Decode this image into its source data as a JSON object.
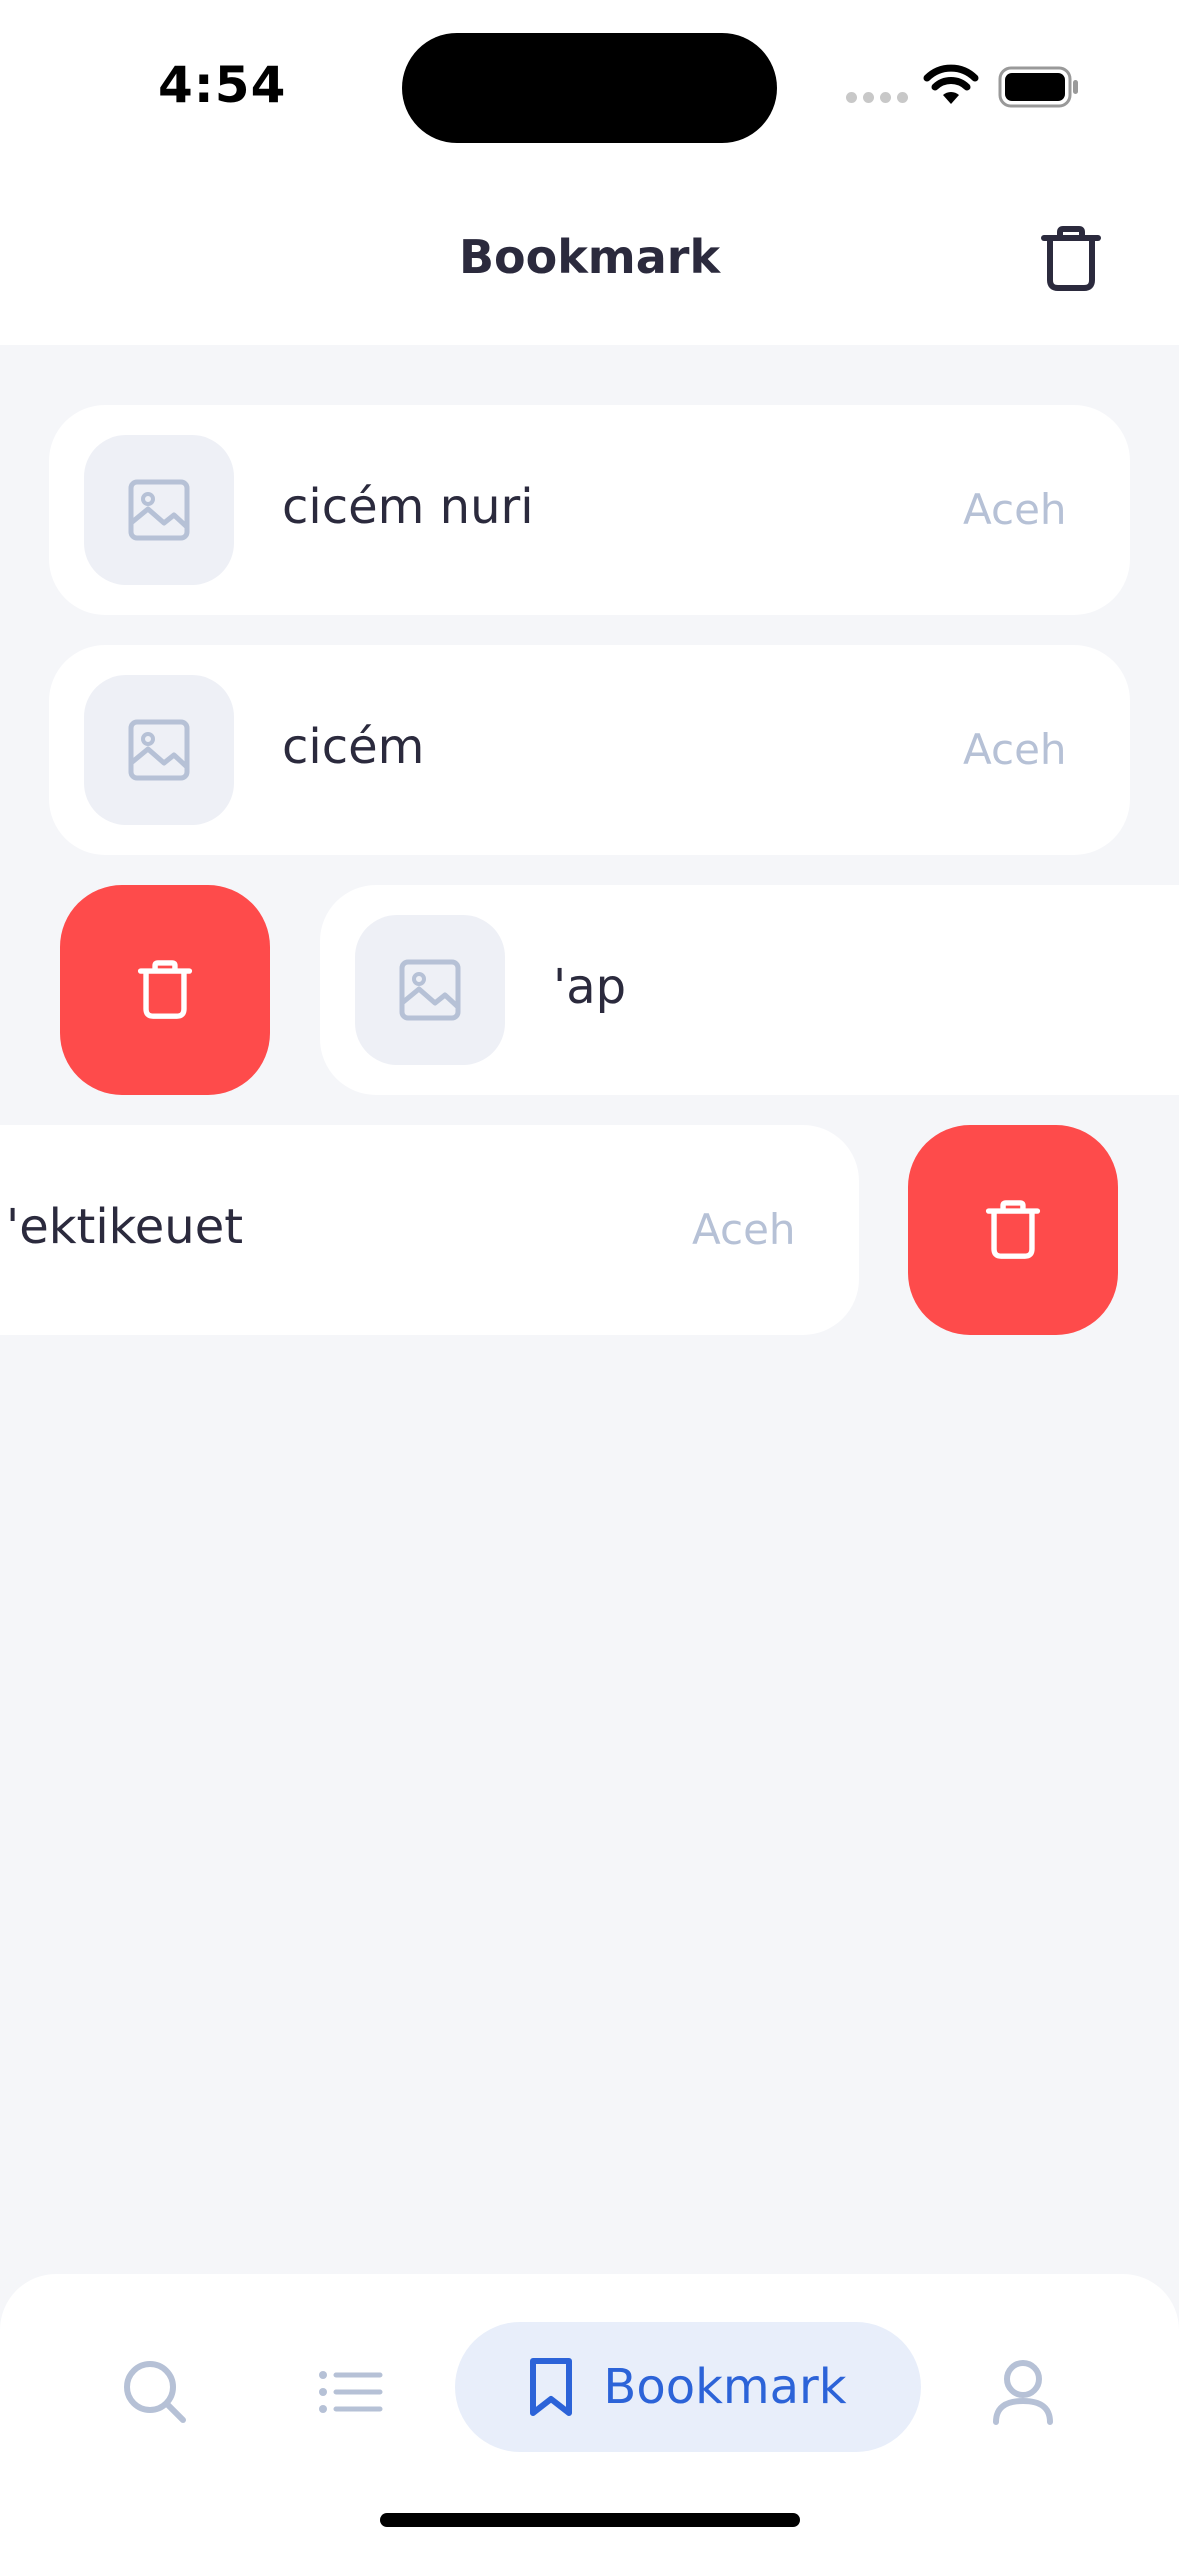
{
  "status": {
    "time": "4:54"
  },
  "header": {
    "title": "Bookmark",
    "trash_icon": "trash-icon"
  },
  "items": [
    {
      "title": "cicém nuri",
      "region": "Aceh"
    },
    {
      "title": "cicém",
      "region": "Aceh"
    },
    {
      "title": "'ap",
      "region": ""
    },
    {
      "title": "'ektikeuet",
      "region": "Aceh"
    }
  ],
  "nav": {
    "search_icon": "search-icon",
    "list_icon": "list-icon",
    "bookmark_label": "Bookmark",
    "profile_icon": "profile-icon"
  },
  "colors": {
    "accent": "#2c63d8",
    "danger": "#fe4b4b",
    "muted": "#b6c1d6",
    "background": "#f5f6f9"
  }
}
